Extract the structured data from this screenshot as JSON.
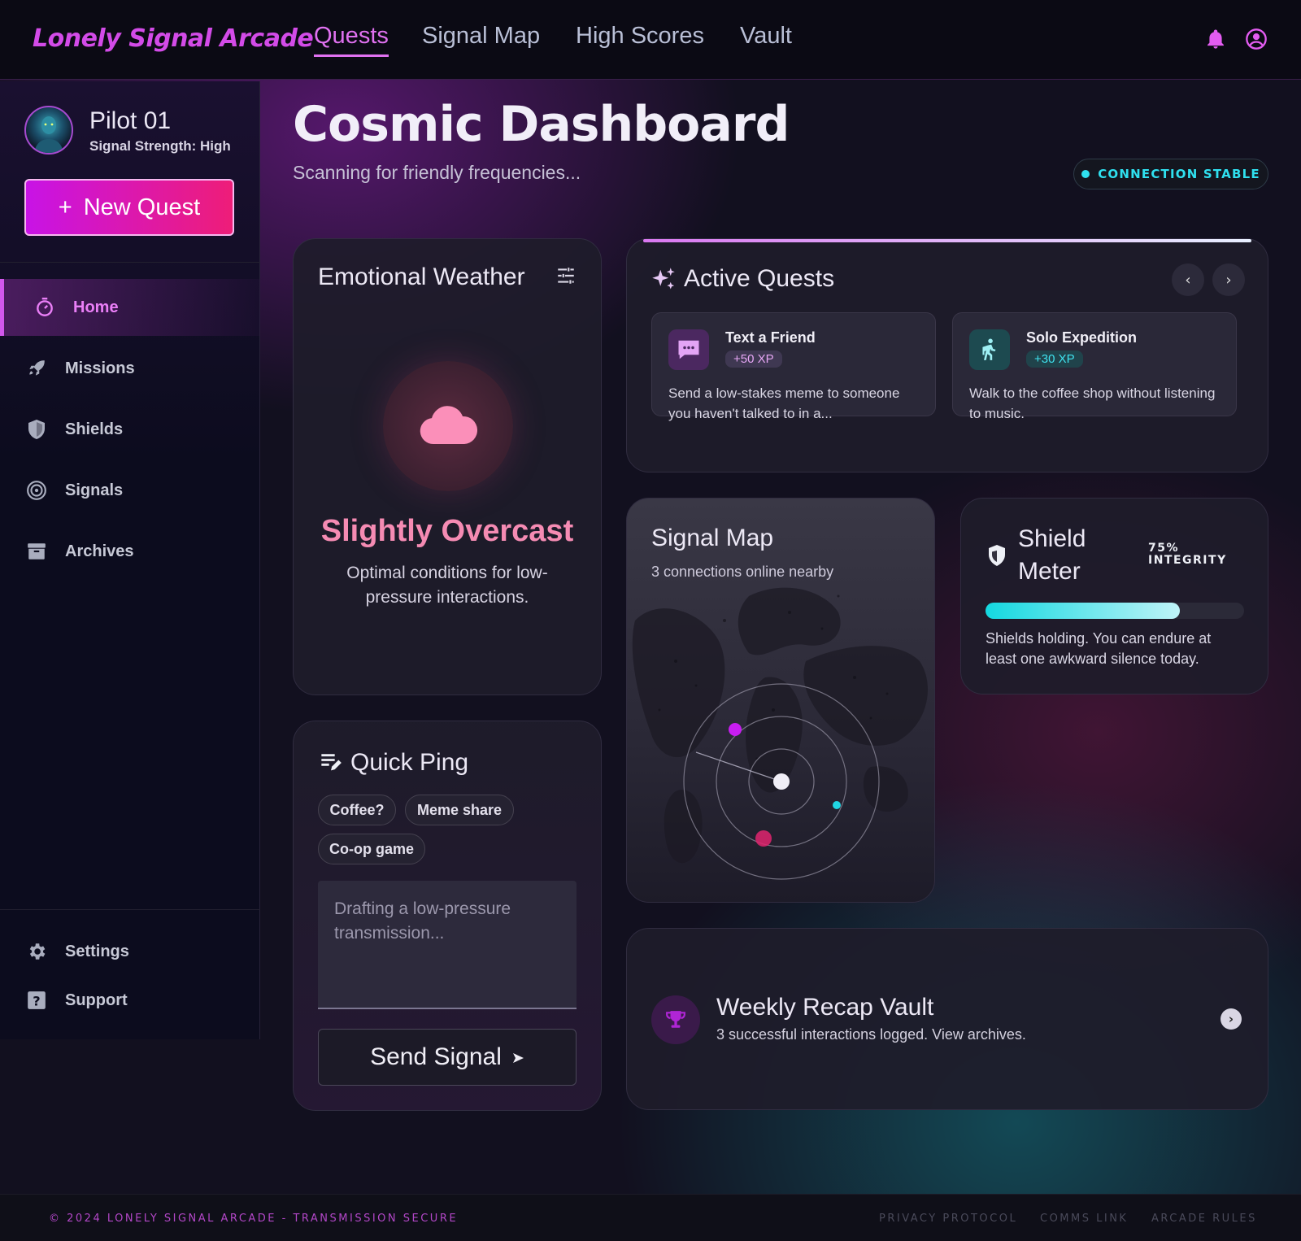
{
  "app": {
    "brand": "Lonely Signal Arcade"
  },
  "topnav": {
    "links": [
      "Quests",
      "Signal Map",
      "High Scores",
      "Vault"
    ],
    "active": "Quests",
    "icons": [
      "bell-icon",
      "account-circle-icon"
    ]
  },
  "sidebar": {
    "pilot_name": "Pilot 01",
    "pilot_status": "Signal Strength: High",
    "new_quest_label": "New Quest",
    "items": [
      {
        "label": "Home",
        "icon": "timer-icon",
        "active": true
      },
      {
        "label": "Missions",
        "icon": "rocket-icon"
      },
      {
        "label": "Shields",
        "icon": "shield-icon"
      },
      {
        "label": "Signals",
        "icon": "target-icon"
      },
      {
        "label": "Archives",
        "icon": "archive-icon"
      }
    ],
    "footer_items": [
      {
        "label": "Settings",
        "icon": "gear-icon"
      },
      {
        "label": "Support",
        "icon": "help-icon"
      }
    ]
  },
  "header": {
    "title": "Cosmic Dashboard",
    "subtitle": "Scanning for friendly frequencies...",
    "status": "CONNECTION STABLE"
  },
  "weather": {
    "title": "Emotional Weather",
    "condition": "Slightly Overcast",
    "description": "Optimal conditions for low-pressure interactions."
  },
  "quests": {
    "title": "Active Quests",
    "items": [
      {
        "name": "Text a Friend",
        "xp": "+50 XP",
        "description": "Send a low-stakes meme to someone you haven't talked to in a...",
        "icon": "chat-bubble-icon"
      },
      {
        "name": "Solo Expedition",
        "xp": "+30 XP",
        "description": "Walk to the coffee shop without listening to music.",
        "icon": "walking-person-icon"
      }
    ]
  },
  "signal_map": {
    "title": "Signal Map",
    "subtitle": "3 connections online nearby"
  },
  "shield": {
    "title_line1": "Shield",
    "title_line2": "Meter",
    "integrity_value": "75%",
    "integrity_label": "INTEGRITY",
    "level": 0.75,
    "description": "Shields holding. You can endure at least one awkward silence today."
  },
  "quick_ping": {
    "title": "Quick Ping",
    "chips": [
      "Coffee?",
      "Meme share",
      "Co-op game"
    ],
    "placeholder": "Drafting a low-pressure transmission...",
    "send_label": "Send Signal"
  },
  "recap": {
    "title": "Weekly Recap Vault",
    "subtitle": "3 successful interactions logged. View archives."
  },
  "footer": {
    "copyright": "© 2024 LONELY SIGNAL ARCADE - TRANSMISSION SECURE",
    "links": [
      "PRIVACY PROTOCOL",
      "COMMS LINK",
      "ARCADE RULES"
    ]
  },
  "colors": {
    "accent": "#d34be8",
    "cyan": "#2fe0ef",
    "pink": "#f58bb3",
    "background": "#12101f"
  }
}
